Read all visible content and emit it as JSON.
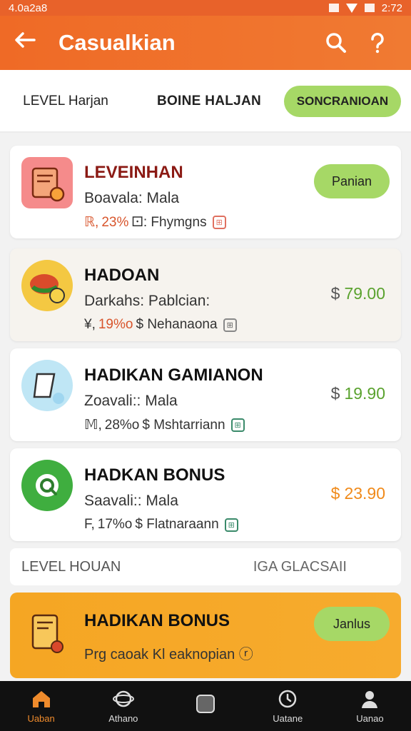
{
  "status_bar": {
    "left_text": "4.0a2a8",
    "time": "2:72"
  },
  "app_bar": {
    "back_icon": "arrow-left-icon",
    "title": "Casualkian",
    "search_icon": "search-icon",
    "help_icon": "question-icon"
  },
  "tabs": [
    {
      "label": "LEVEL Harjan"
    },
    {
      "label": "BOINE HALJAN"
    },
    {
      "label": "SONCRANIOAN"
    }
  ],
  "cards": [
    {
      "title": "LEVEINHAN",
      "line1": "Boavala: Mala",
      "line2_prefix": "ℝ, ",
      "pct": "23%",
      "line2_rest": " ⚀: Fhymgns",
      "button": "Panian",
      "icon": "coupon-icon",
      "title_color": "#8b1a14"
    },
    {
      "title": "HADOAN",
      "line1": "Darkahs: Pablcian:",
      "line2_prefix": "¥, ",
      "pct": "19%o",
      "line2_rest": " $ Nehanaona",
      "currency": "$",
      "price": "79.00",
      "icon": "food-icon",
      "title_color": "#111"
    },
    {
      "title": "HADIKAN GAMIANON",
      "line1": "Zoavali:: Mala",
      "line2_prefix": "𝕄, ",
      "pct": "28%o",
      "line2_rest": " $ Mshtarriann",
      "currency": "$",
      "price": "19.90",
      "icon": "ticket-icon",
      "title_color": "#111"
    },
    {
      "title": "HADKAN BONUS",
      "line1": "Saavali:: Mala",
      "line2_prefix": "F, ",
      "pct": "17%o",
      "line2_rest": " $ Flatnaraann",
      "currency": "$",
      "price": "23.90",
      "icon": "gift-icon",
      "title_color": "#111"
    }
  ],
  "level_row": {
    "left": "LEVEL HOUAN",
    "right": "IGA GLACSAII"
  },
  "promo": {
    "title": "HADIKAN BONUS",
    "line1": "Prg caoak Kl eaknopian ⓡ",
    "button": "Janlus",
    "icon": "bonus-icon"
  },
  "bottom_nav": [
    {
      "label": "Uaban",
      "icon": "home-icon",
      "active": true
    },
    {
      "label": "Athano",
      "icon": "planet-icon",
      "active": false
    },
    {
      "label": "",
      "icon": "square-icon",
      "active": false
    },
    {
      "label": "Uatane",
      "icon": "clock-icon",
      "active": false
    },
    {
      "label": "Uanao",
      "icon": "user-icon",
      "active": false
    }
  ],
  "colors": {
    "primary": "#e8622a",
    "accent_green": "#a6d866",
    "promo_orange": "#f5a623",
    "price_green": "#5aa22e"
  }
}
